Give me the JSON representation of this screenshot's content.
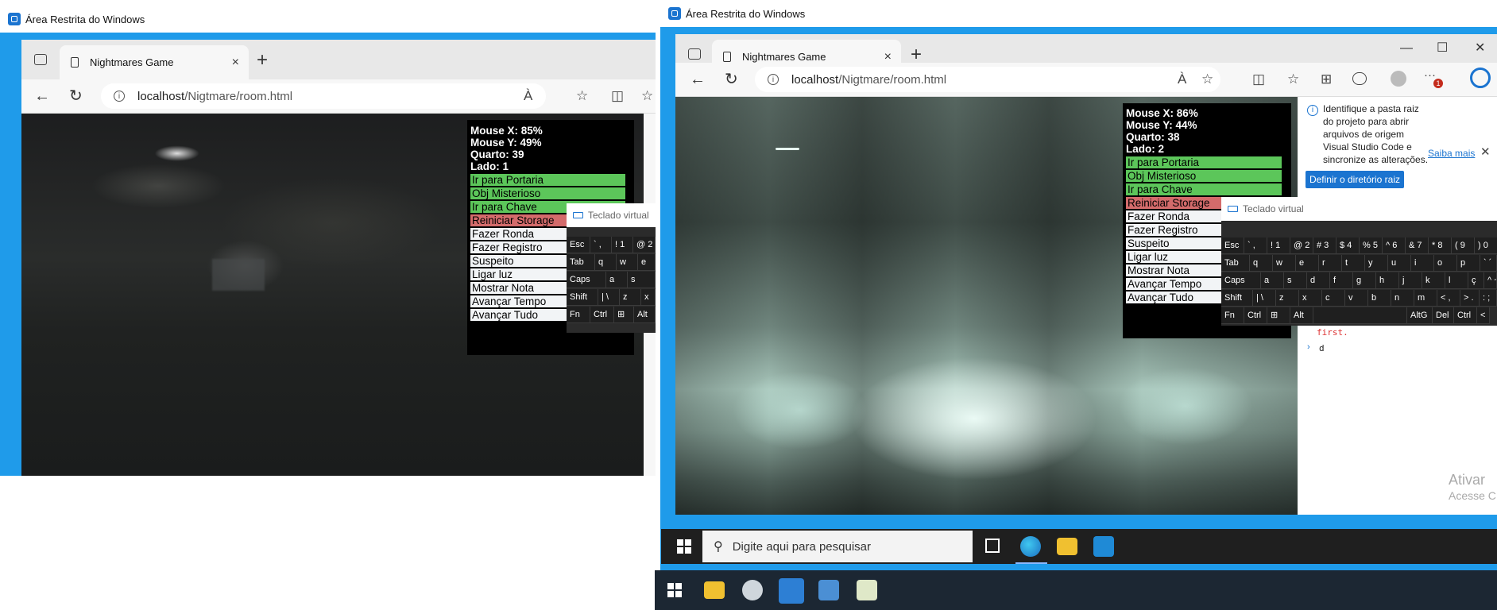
{
  "sandbox": {
    "title": "Área Restrita do Windows"
  },
  "browser": {
    "tab_title": "Nightmares Game",
    "tab_close": "×",
    "new_tab": "+",
    "url_host": "localhost",
    "url_path": "/Nigtmare/room.html",
    "back": "←",
    "refresh": "↻",
    "read_aloud": "À",
    "favorite": "☆",
    "split": "◫",
    "favorites": "☆",
    "collections": "⊞",
    "more": "···",
    "profile_badge": "1",
    "minimize": "—",
    "maximize": "☐",
    "close": "✕"
  },
  "left_game": {
    "stats": [
      "Mouse X: 85%",
      "Mouse Y: 49%",
      "Quarto: 39",
      "Lado: 1"
    ],
    "buttons": [
      {
        "label": "Ir para Portaria",
        "color": "green"
      },
      {
        "label": "Obj Misterioso",
        "color": "green"
      },
      {
        "label": "Ir para Chave",
        "color": "green"
      },
      {
        "label": "Reiniciar Storage",
        "color": "red"
      },
      {
        "label": "Fazer Ronda",
        "color": "white"
      },
      {
        "label": "Fazer Registro",
        "color": "white"
      },
      {
        "label": "Suspeito",
        "color": "white"
      },
      {
        "label": "Ligar luz",
        "color": "white"
      },
      {
        "label": "Mostrar Nota",
        "color": "white"
      },
      {
        "label": "Avançar Tempo",
        "color": "white"
      },
      {
        "label": "Avançar Tudo",
        "color": "white"
      }
    ]
  },
  "right_game": {
    "stats": [
      "Mouse X: 86%",
      "Mouse Y: 44%",
      "Quarto: 38",
      "Lado: 2"
    ],
    "buttons": [
      {
        "label": "Ir para Portaria",
        "color": "green"
      },
      {
        "label": "Obj Misterioso",
        "color": "green"
      },
      {
        "label": "Ir para Chave",
        "color": "green"
      },
      {
        "label": "Reiniciar Storage",
        "color": "red"
      },
      {
        "label": "Fazer Ronda",
        "color": "white"
      },
      {
        "label": "Fazer Registro",
        "color": "white"
      },
      {
        "label": "Suspeito",
        "color": "white"
      },
      {
        "label": "Ligar luz",
        "color": "white"
      },
      {
        "label": "Mostrar Nota",
        "color": "white"
      },
      {
        "label": "Avançar Tempo",
        "color": "white"
      },
      {
        "label": "Avançar Tudo",
        "color": "white"
      }
    ]
  },
  "virtual_keyboard": {
    "title": "Teclado virtual",
    "left_rows": [
      [
        "Esc",
        "` ,",
        "! 1",
        "@ 2"
      ],
      [
        "Tab",
        "q",
        "w",
        "e"
      ],
      [
        "Caps",
        "a",
        "s"
      ],
      [
        "Shift",
        "| \\",
        "z",
        "x"
      ],
      [
        "Fn",
        "Ctrl",
        "⊞",
        "Alt"
      ]
    ],
    "right_rows": [
      [
        "Esc",
        "` ,",
        "! 1",
        "@ 2",
        "# 3",
        "$ 4",
        "% 5",
        "^ 6",
        "& 7",
        "* 8",
        "( 9",
        ") 0",
        "_ -"
      ],
      [
        "Tab",
        "q",
        "w",
        "e",
        "r",
        "t",
        "y",
        "u",
        "i",
        "o",
        "p",
        "` ´"
      ],
      [
        "Caps",
        "a",
        "s",
        "d",
        "f",
        "g",
        "h",
        "j",
        "k",
        "l",
        "ç",
        "^ ~"
      ],
      [
        "Shift",
        "| \\",
        "z",
        "x",
        "c",
        "v",
        "b",
        "n",
        "m",
        "< ,",
        "> .",
        ": ;"
      ],
      [
        "Fn",
        "Ctrl",
        "⊞",
        "Alt",
        "",
        "AltG",
        "Del",
        "Ctrl",
        "<"
      ]
    ]
  },
  "devtools": {
    "message": "Identifique a pasta raiz do projeto para abrir arquivos de origem Visual Studio Code e sincronize as alterações.",
    "learn_more": "Saiba mais",
    "set_root_button": "Definir o diretório raiz",
    "console_error": "first.",
    "console_prompt": "d"
  },
  "watermark": {
    "line1": "Ativar",
    "line2": "Acesse C"
  },
  "taskbar": {
    "search_placeholder": "Digite aqui para pesquisar"
  },
  "colors": {
    "sandbox_frame": "#1f9bea",
    "taskbar_dark": "#1f1f1f",
    "accent_blue": "#1b74d0",
    "button_green": "#5cc65a",
    "button_red": "#d46b6b"
  }
}
